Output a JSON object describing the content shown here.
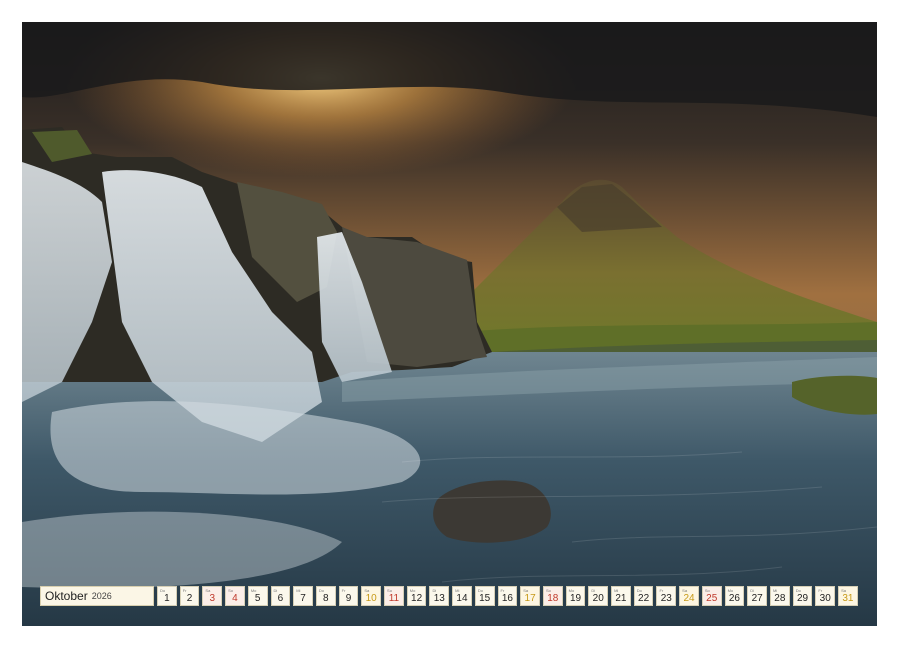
{
  "calendar": {
    "month": "Oktober",
    "year": "2026",
    "days": [
      {
        "abbr": "Do",
        "num": "1",
        "type": "weekday"
      },
      {
        "abbr": "Fr",
        "num": "2",
        "type": "weekday"
      },
      {
        "abbr": "Sa",
        "num": "3",
        "type": "sun"
      },
      {
        "abbr": "So",
        "num": "4",
        "type": "sun"
      },
      {
        "abbr": "Mo",
        "num": "5",
        "type": "weekday"
      },
      {
        "abbr": "Di",
        "num": "6",
        "type": "weekday"
      },
      {
        "abbr": "Mi",
        "num": "7",
        "type": "weekday"
      },
      {
        "abbr": "Do",
        "num": "8",
        "type": "weekday"
      },
      {
        "abbr": "Fr",
        "num": "9",
        "type": "weekday"
      },
      {
        "abbr": "Sa",
        "num": "10",
        "type": "sat"
      },
      {
        "abbr": "So",
        "num": "11",
        "type": "sun"
      },
      {
        "abbr": "Mo",
        "num": "12",
        "type": "weekday"
      },
      {
        "abbr": "Di",
        "num": "13",
        "type": "weekday"
      },
      {
        "abbr": "Mi",
        "num": "14",
        "type": "weekday"
      },
      {
        "abbr": "Do",
        "num": "15",
        "type": "weekday"
      },
      {
        "abbr": "Fr",
        "num": "16",
        "type": "weekday"
      },
      {
        "abbr": "Sa",
        "num": "17",
        "type": "sat"
      },
      {
        "abbr": "So",
        "num": "18",
        "type": "sun"
      },
      {
        "abbr": "Mo",
        "num": "19",
        "type": "weekday"
      },
      {
        "abbr": "Di",
        "num": "20",
        "type": "weekday"
      },
      {
        "abbr": "Mi",
        "num": "21",
        "type": "weekday"
      },
      {
        "abbr": "Do",
        "num": "22",
        "type": "weekday"
      },
      {
        "abbr": "Fr",
        "num": "23",
        "type": "weekday"
      },
      {
        "abbr": "Sa",
        "num": "24",
        "type": "sat"
      },
      {
        "abbr": "So",
        "num": "25",
        "type": "sun"
      },
      {
        "abbr": "Mo",
        "num": "26",
        "type": "weekday"
      },
      {
        "abbr": "Di",
        "num": "27",
        "type": "weekday"
      },
      {
        "abbr": "Mi",
        "num": "28",
        "type": "weekday"
      },
      {
        "abbr": "Do",
        "num": "29",
        "type": "weekday"
      },
      {
        "abbr": "Fr",
        "num": "30",
        "type": "weekday"
      },
      {
        "abbr": "Sa",
        "num": "31",
        "type": "sat"
      }
    ]
  },
  "colors": {
    "saturday": "#c79a18",
    "sunday": "#c0392b",
    "cell_bg": "#fbf8ec"
  }
}
